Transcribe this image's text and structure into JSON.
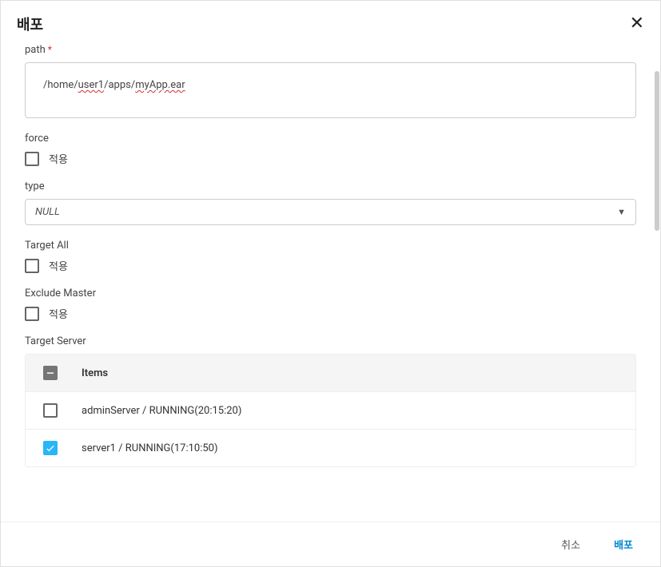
{
  "modal": {
    "title": "배포"
  },
  "fields": {
    "path": {
      "label": "path",
      "value_parts": {
        "p1": "/home/",
        "p2": "user1",
        "p3": "/apps/",
        "p4": "myApp.ear"
      }
    },
    "force": {
      "label": "force",
      "checkbox_label": "적용"
    },
    "type": {
      "label": "type",
      "value": "NULL"
    },
    "target_all": {
      "label": "Target All",
      "checkbox_label": "적용"
    },
    "exclude_master": {
      "label": "Exclude Master",
      "checkbox_label": "적용"
    },
    "target_server": {
      "label": "Target Server",
      "header": "Items",
      "rows": {
        "0": {
          "text": "adminServer / RUNNING(20:15:20)"
        },
        "1": {
          "text": "server1 / RUNNING(17:10:50)"
        }
      }
    }
  },
  "footer": {
    "cancel": "취소",
    "submit": "배포"
  }
}
